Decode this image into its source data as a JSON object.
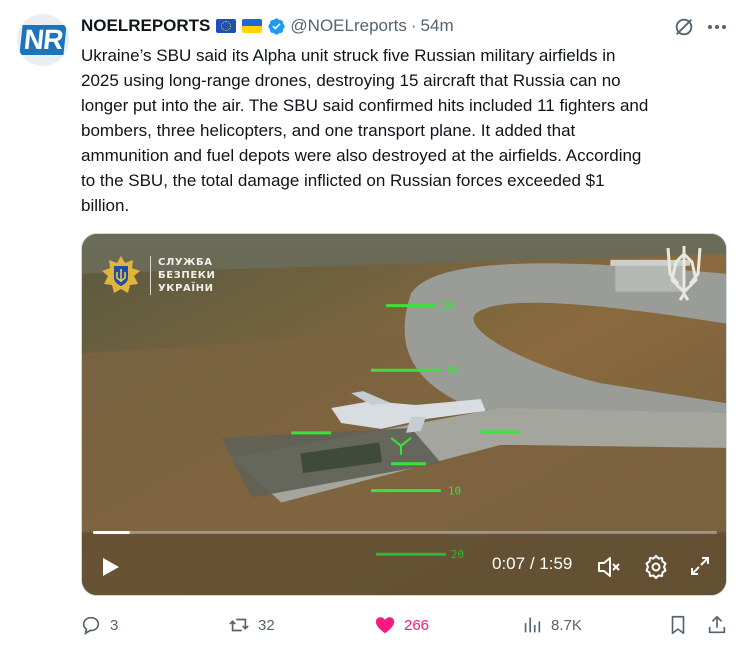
{
  "avatar": {
    "text": "NR",
    "color": "#1c75bc"
  },
  "author": {
    "name": "NOELREPORTS",
    "handle": "@NOELreports",
    "separator": "·",
    "time": "54m",
    "flags": [
      "eu-flag-icon",
      "ukraine-flag-icon"
    ],
    "verified_icon": "verified-badge-icon"
  },
  "tweet": {
    "text": "Ukraine’s SBU said its Alpha unit struck five Russian military airfields in\n2025 using long-range drones, destroying 15 aircraft that Russia can no\nlonger put into the air. The SBU said confirmed hits included 11 fighters and\nbombers, three helicopters, and one transport plane. It added that\nammunition and fuel depots were also destroyed at the airfields. According\nto the SBU, the total damage inflicted on Russian forces exceeded $1\nbillion."
  },
  "video": {
    "overlay_logo": {
      "line1": "СЛУЖБА",
      "line2": "БЕЗПЕКИ",
      "line3": "УКРАЇНИ"
    },
    "hud_labels": [
      "20",
      "10",
      "10",
      "20"
    ],
    "current_time": "0:07",
    "duration": "1:59",
    "time_separator": " / ",
    "progress_fraction": 0.06,
    "controls": [
      "play-icon",
      "volume-icon",
      "settings-gear-icon",
      "fullscreen-icon"
    ]
  },
  "actions": {
    "replies": "3",
    "reposts": "32",
    "likes": "266",
    "views": "8.7K"
  },
  "colors": {
    "like_pink": "#f91880",
    "secondary_text": "#536471",
    "verified_blue": "#1d9bf0"
  }
}
